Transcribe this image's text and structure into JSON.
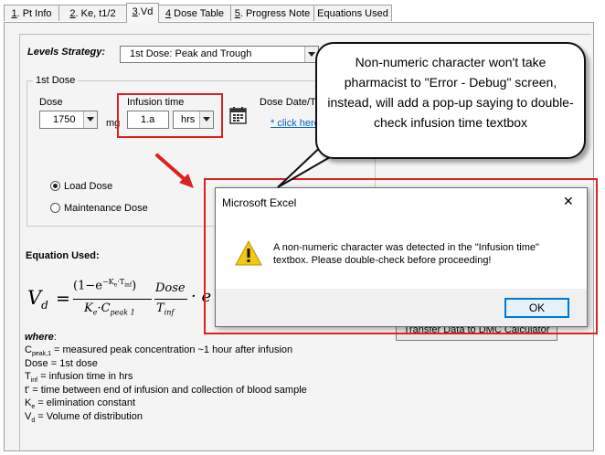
{
  "tabs": [
    {
      "key": "1",
      "label": ". Pt Info",
      "active": false
    },
    {
      "key": "2",
      "label": ". Ke, t1/2",
      "active": false
    },
    {
      "key": "3",
      "label": ".Vd",
      "active": true
    },
    {
      "key": "4",
      "label": " Dose Table",
      "active": false
    },
    {
      "key": "5",
      "label": ". Progress Note",
      "active": false
    },
    {
      "key": "",
      "label": "Equations Used",
      "active": false
    }
  ],
  "levels": {
    "label": "Levels Strategy:",
    "value": "1st Dose: Peak and Trough"
  },
  "first_dose": {
    "group_label": "1st Dose",
    "dose_label": "Dose",
    "dose_value": "1750",
    "dose_unit": "mg",
    "infusion_label": "Infusion time",
    "infusion_value": "1.a",
    "infusion_unit": "hrs",
    "date_label": "Dose Date/Ti",
    "date_link": "* click here",
    "load_dose": "Load Dose",
    "maintenance_dose": "Maintenance Dose"
  },
  "equation": {
    "heading": "Equation Used:",
    "lhs": "V",
    "lhs_sub": "d",
    "num_open": "(1−e",
    "num_exp": "−K",
    "num_exp_sub": "e",
    "num_exp_rest": "·T",
    "num_exp_sub2": "inf",
    "num_close": ")",
    "den_k": "K",
    "den_k_sub": "e",
    "den_c": "·C",
    "den_c_sub": "peak 1",
    "frac2_num": "Dose",
    "frac2_den": "T",
    "frac2_den_sub": "inf",
    "tail": "· e"
  },
  "where": {
    "label": "where",
    "colon": ":",
    "lines": [
      {
        "sym": "C",
        "sub": "peak,1",
        "text": " = measured peak concentration ~1 hour after infusion"
      },
      {
        "sym": "Dose",
        "sub": "",
        "text": " = 1st dose"
      },
      {
        "sym": "T",
        "sub": "inf",
        "text": " = infusion time in hrs"
      },
      {
        "sym": "t'",
        "sub": "",
        "text": " = time between end of infusion and collection of blood sample"
      },
      {
        "sym": "K",
        "sub": "e",
        "text": " = elimination constant"
      },
      {
        "sym": "V",
        "sub": "d",
        "text": " = Volume of distribution"
      }
    ]
  },
  "transfer_button": "Transfer Data to DMC Calculator",
  "dialog": {
    "title": "Microsoft Excel",
    "close": "✕",
    "message": "A non-numeric character was detected in the \"Infusion time\" textbox.  Please double-check before proceeding!",
    "ok": "OK"
  },
  "callout": {
    "text": "Non-numeric character won't take pharmacist to \"Error - Debug\" screen, instead, will add a pop-up saying to double-check infusion time textbox"
  },
  "colors": {
    "annotation_red": "#e02020",
    "link_blue": "#0066cc",
    "focus_blue": "#0078d7",
    "warning_yellow": "#f2c811"
  }
}
